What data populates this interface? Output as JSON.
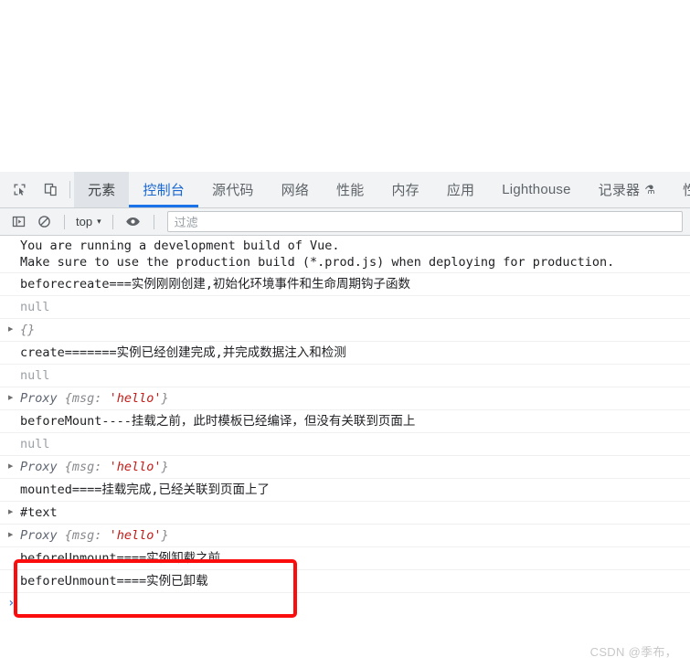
{
  "tabstrip": {
    "icons": [
      {
        "name": "inspect-element-icon",
        "label": "检查元素"
      },
      {
        "name": "device-toolbar-icon",
        "label": "切换设备工具栏"
      }
    ],
    "tabs": [
      {
        "label": "元素",
        "state": "hovered"
      },
      {
        "label": "控制台",
        "state": "active"
      },
      {
        "label": "源代码",
        "state": "normal"
      },
      {
        "label": "网络",
        "state": "normal"
      },
      {
        "label": "性能",
        "state": "normal"
      },
      {
        "label": "内存",
        "state": "normal"
      },
      {
        "label": "应用",
        "state": "normal"
      },
      {
        "label": "Lighthouse",
        "state": "normal"
      },
      {
        "label": "记录器",
        "state": "normal",
        "badge": "⚗"
      },
      {
        "label": "性",
        "state": "normal"
      }
    ]
  },
  "console_toolbar": {
    "sidebar_toggle": "console-sidebar-icon",
    "clear_button": "clear-console-icon",
    "context_value": "top",
    "context_caret": "▾",
    "eye_button": "live-expression-icon",
    "filter_placeholder": "过滤"
  },
  "console": {
    "messages": [
      {
        "type": "warning-text",
        "lines": [
          "You are running a development build of Vue.",
          "Make sure to use the production build (*.prod.js) when deploying for production."
        ]
      },
      {
        "type": "text",
        "text": "beforecreate===实例刚刚创建,初始化环境事件和生命周期钩子函数"
      },
      {
        "type": "null",
        "text": "null"
      },
      {
        "type": "object",
        "arrow": "▶",
        "name": "",
        "body": "{}"
      },
      {
        "type": "text",
        "text": "create=======实例已经创建完成,并完成数据注入和检测"
      },
      {
        "type": "null",
        "text": "null"
      },
      {
        "type": "proxy",
        "arrow": "▶",
        "name": "Proxy",
        "open": "{",
        "key": "msg:",
        "value": "'hello'",
        "close": "}"
      },
      {
        "type": "text",
        "text": "beforeMount----挂载之前，此时模板已经编译，但没有关联到页面上"
      },
      {
        "type": "null",
        "text": "null"
      },
      {
        "type": "proxy",
        "arrow": "▶",
        "name": "Proxy",
        "open": "{",
        "key": "msg:",
        "value": "'hello'",
        "close": "}"
      },
      {
        "type": "text",
        "text": "mounted====挂载完成,已经关联到页面上了"
      },
      {
        "type": "node",
        "arrow": "▶",
        "text": "#text"
      },
      {
        "type": "proxy",
        "arrow": "▶",
        "name": "Proxy",
        "open": "{",
        "key": "msg:",
        "value": "'hello'",
        "close": "}"
      },
      {
        "type": "text",
        "text": "beforeUnmount====实例卸载之前"
      },
      {
        "type": "text",
        "text": "beforeUnmount====实例已卸载"
      }
    ],
    "prompt_caret": "›"
  },
  "annotation": {
    "box_color": "#fc0d0d"
  },
  "watermark": {
    "text": "CSDN @季布，"
  }
}
